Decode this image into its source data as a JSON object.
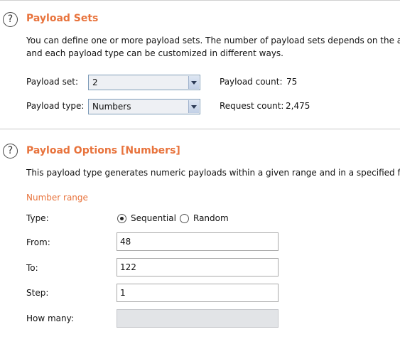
{
  "payload_sets": {
    "title": "Payload Sets",
    "desc_line1": "You can define one or more payload sets. The number of payload sets depends on the attac",
    "desc_line2": "and each payload type can be customized in different ways.",
    "set_label": "Payload set:",
    "set_value": "2",
    "count_label": "Payload count:",
    "count_value": "75",
    "type_label": "Payload type:",
    "type_value": "Numbers",
    "request_label": "Request count:",
    "request_value": "2,475"
  },
  "payload_options": {
    "title": "Payload Options [Numbers]",
    "desc": "This payload type generates numeric payloads within a given range and in a specified forma",
    "range_title": "Number range",
    "type_label": "Type:",
    "sequential_label": "Sequential",
    "random_label": "Random",
    "selected_type": "Sequential",
    "from_label": "From:",
    "from_value": "48",
    "to_label": "To:",
    "to_value": "122",
    "step_label": "Step:",
    "step_value": "1",
    "howmany_label": "How many:",
    "howmany_value": ""
  }
}
